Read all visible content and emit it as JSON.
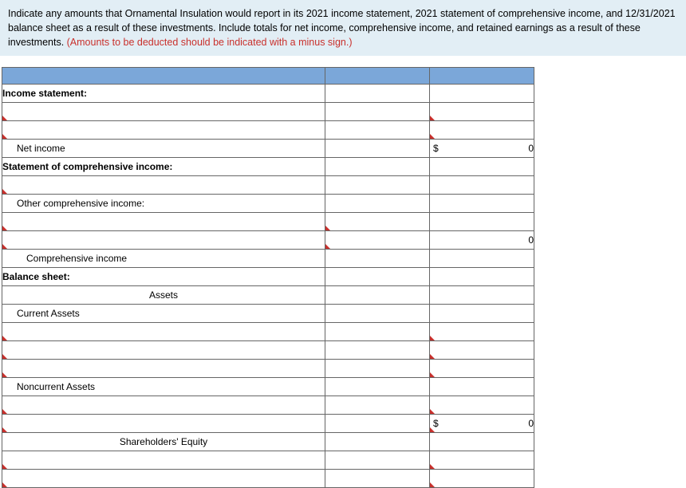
{
  "instruction": {
    "main": "Indicate any amounts that Ornamental Insulation would report in its 2021 income statement, 2021 statement of comprehensive income, and 12/31/2021 balance sheet as a result of these investments. Include totals for net income, comprehensive income, and retained earnings as a result of these investments. ",
    "red": "(Amounts to be deducted should be indicated with a minus sign.)"
  },
  "rows": [
    {
      "label": "Income statement:",
      "class": "bold",
      "label_dd": false,
      "mid_dd": false,
      "val_dd": false,
      "cur": "",
      "val": ""
    },
    {
      "label": "",
      "class": "",
      "label_dd": true,
      "mid_dd": false,
      "val_dd": true,
      "cur": "",
      "val": ""
    },
    {
      "label": "",
      "class": "",
      "label_dd": true,
      "mid_dd": false,
      "val_dd": true,
      "cur": "",
      "val": ""
    },
    {
      "label": "Net income",
      "class": "indent1",
      "label_dd": false,
      "mid_dd": false,
      "val_dd": false,
      "cur": "$",
      "val": "0"
    },
    {
      "label": "Statement of comprehensive income:",
      "class": "bold",
      "label_dd": false,
      "mid_dd": false,
      "val_dd": false,
      "cur": "",
      "val": ""
    },
    {
      "label": "",
      "class": "",
      "label_dd": true,
      "mid_dd": false,
      "val_dd": false,
      "cur": "",
      "val": ""
    },
    {
      "label": "Other comprehensive income:",
      "class": "indent1",
      "label_dd": false,
      "mid_dd": false,
      "val_dd": false,
      "cur": "",
      "val": ""
    },
    {
      "label": "",
      "class": "",
      "label_dd": true,
      "mid_dd": true,
      "val_dd": false,
      "cur": "",
      "val": ""
    },
    {
      "label": "",
      "class": "",
      "label_dd": true,
      "mid_dd": true,
      "val_dd": false,
      "cur": "",
      "val": "0"
    },
    {
      "label": "Comprehensive income",
      "class": "indent2",
      "label_dd": false,
      "mid_dd": false,
      "val_dd": false,
      "cur": "",
      "val": ""
    },
    {
      "label": "Balance sheet:",
      "class": "bold",
      "label_dd": false,
      "mid_dd": false,
      "val_dd": false,
      "cur": "",
      "val": ""
    },
    {
      "label": "Assets",
      "class": "center",
      "label_dd": false,
      "mid_dd": false,
      "val_dd": false,
      "cur": "",
      "val": ""
    },
    {
      "label": "Current Assets",
      "class": "indent1",
      "label_dd": false,
      "mid_dd": false,
      "val_dd": false,
      "cur": "",
      "val": ""
    },
    {
      "label": "",
      "class": "",
      "label_dd": true,
      "mid_dd": false,
      "val_dd": true,
      "cur": "",
      "val": ""
    },
    {
      "label": "",
      "class": "",
      "label_dd": true,
      "mid_dd": false,
      "val_dd": true,
      "cur": "",
      "val": ""
    },
    {
      "label": "",
      "class": "",
      "label_dd": true,
      "mid_dd": false,
      "val_dd": true,
      "cur": "",
      "val": ""
    },
    {
      "label": "Noncurrent Assets",
      "class": "indent1",
      "label_dd": false,
      "mid_dd": false,
      "val_dd": false,
      "cur": "",
      "val": ""
    },
    {
      "label": "",
      "class": "",
      "label_dd": true,
      "mid_dd": false,
      "val_dd": true,
      "cur": "",
      "val": ""
    },
    {
      "label": "",
      "class": "",
      "label_dd": true,
      "mid_dd": false,
      "val_dd": true,
      "cur": "$",
      "val": "0"
    },
    {
      "label": "Shareholders' Equity",
      "class": "center",
      "label_dd": false,
      "mid_dd": false,
      "val_dd": false,
      "cur": "",
      "val": ""
    },
    {
      "label": "",
      "class": "",
      "label_dd": true,
      "mid_dd": false,
      "val_dd": true,
      "cur": "",
      "val": ""
    },
    {
      "label": "",
      "class": "",
      "label_dd": true,
      "mid_dd": false,
      "val_dd": true,
      "cur": "",
      "val": ""
    }
  ]
}
